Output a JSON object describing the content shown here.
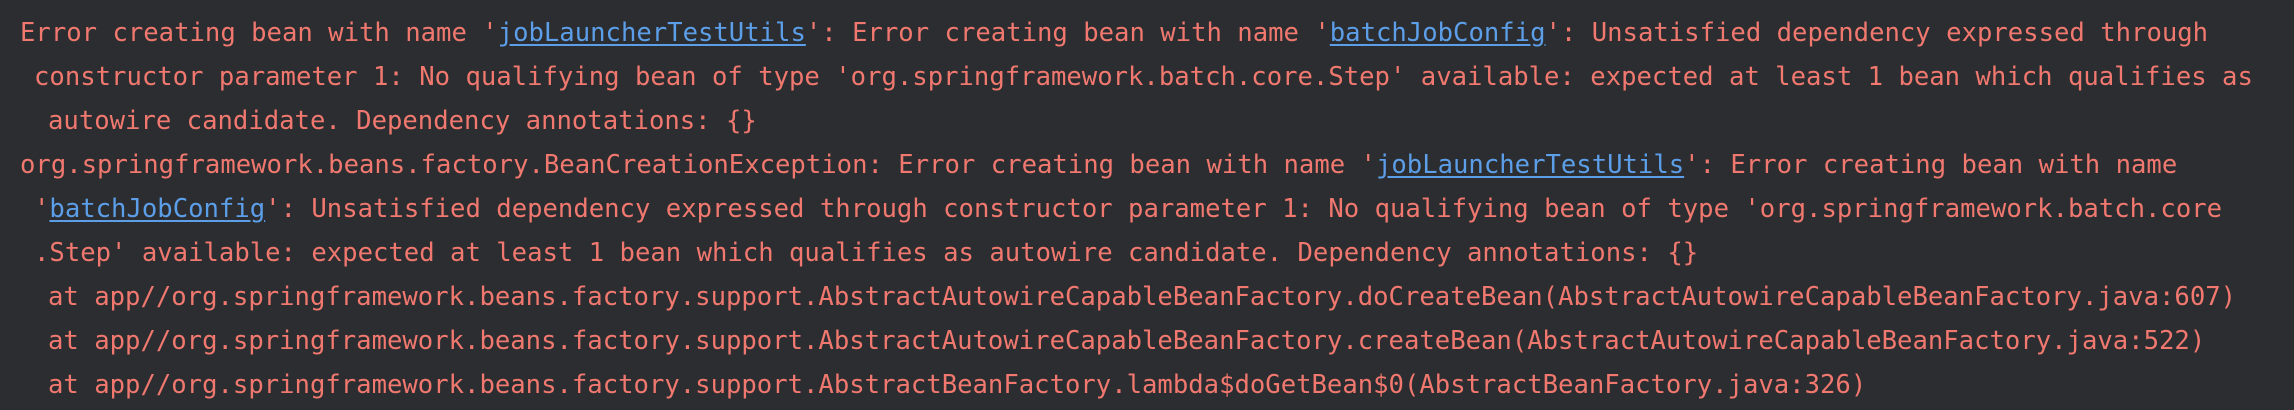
{
  "console": {
    "colors": {
      "background": "#2b2d30",
      "error_text": "#f0786f",
      "link": "#5c9ee8"
    },
    "lines": [
      {
        "t1": "Error creating bean with name '",
        "link1": "jobLauncherTestUtils",
        "t2": "': Error creating bean with name '",
        "link2": "batchJobConfig",
        "t3": "': Unsatisfied dependency expressed through"
      },
      {
        "t1": "constructor parameter 1: No qualifying bean of type 'org.springframework.batch.core.Step' available: expected at least 1 bean which qualifies as"
      },
      {
        "t1": "autowire candidate. Dependency annotations: {}"
      },
      {
        "t1": "org.springframework.beans.factory.BeanCreationException: Error creating bean with name '",
        "link1": "jobLauncherTestUtils",
        "t2": "': Error creating bean with name"
      },
      {
        "t1": "'",
        "link1": "batchJobConfig",
        "t2": "': Unsatisfied dependency expressed through constructor parameter 1: No qualifying bean of type 'org.springframework.batch.core"
      },
      {
        "t1": ".Step' available: expected at least 1 bean which qualifies as autowire candidate. Dependency annotations: {}"
      },
      {
        "t1": "at app//org.springframework.beans.factory.support.AbstractAutowireCapableBeanFactory.doCreateBean(AbstractAutowireCapableBeanFactory.java:607)"
      },
      {
        "t1": "at app//org.springframework.beans.factory.support.AbstractAutowireCapableBeanFactory.createBean(AbstractAutowireCapableBeanFactory.java:522)"
      },
      {
        "t1": "at app//org.springframework.beans.factory.support.AbstractBeanFactory.lambda$doGetBean$0(AbstractBeanFactory.java:326)"
      }
    ]
  }
}
